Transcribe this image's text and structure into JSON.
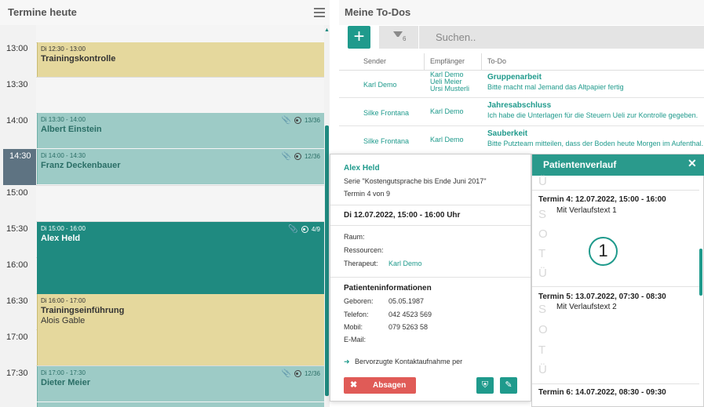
{
  "left": {
    "title": "Termine heute",
    "times": [
      "13:00",
      "13:30",
      "14:00",
      "14:30",
      "15:00",
      "15:30",
      "16:00",
      "16:30",
      "17:00",
      "17:30"
    ],
    "events": [
      {
        "time": "Di 12:30 - 13:00",
        "title": "Trainingskontrolle",
        "sub": "",
        "meta": "",
        "style": "yellow"
      },
      {
        "time": "Di 13:30 - 14:00",
        "title": "Albert Einstein",
        "sub": "",
        "meta": "13/36",
        "style": "teal"
      },
      {
        "time": "Di 14:00 - 14:30",
        "title": "Franz Deckenbauer",
        "sub": "",
        "meta": "12/36",
        "style": "teal"
      },
      {
        "time": "Di 15:00 - 16:00",
        "title": "Alex Held",
        "sub": "",
        "meta": "4/9",
        "style": "active"
      },
      {
        "time": "Di 16:00 - 17:00",
        "title": "Trainingseinführung",
        "sub": "Alois Gable",
        "meta": "",
        "style": "yellow"
      },
      {
        "time": "Di 17:00 - 17:30",
        "title": "Dieter Meier",
        "sub": "",
        "meta": "12/36",
        "style": "teal"
      }
    ]
  },
  "right": {
    "title": "Meine To-Dos",
    "add_label": "+",
    "filter_count": "6",
    "search_placeholder": "Suchen..",
    "columns": [
      "Sender",
      "Empfänger",
      "To-Do"
    ],
    "rows": [
      {
        "sender": "Karl Demo",
        "recv": [
          "Karl Demo",
          "Ueli Meier",
          "Ursi Musterli"
        ],
        "todo_title": "Gruppenarbeit",
        "todo_text": "Bitte macht mal Jemand das Altpapier fertig"
      },
      {
        "sender": "Silke Frontana",
        "recv": [
          "Karl Demo"
        ],
        "todo_title": "Jahresabschluss",
        "todo_text": "Ich habe die Unterlagen für die Steuern Ueli zur Kontrolle gegeben."
      },
      {
        "sender": "Silke Frontana",
        "recv": [
          "Karl Demo"
        ],
        "todo_title": "Sauberkeit",
        "todo_text": "Bitte Putzteam mitteilen, dass der Boden heute Morgen im Aufenthal..."
      }
    ]
  },
  "popup": {
    "name": "Alex Held",
    "series": "Serie \"Kostengutsprache bis Ende Juni 2017\"",
    "termin": "Termin 4 von 9",
    "date": "Di 12.07.2022, 15:00 - 16:00 Uhr",
    "raum_label": "Raum:",
    "ressourcen_label": "Ressourcen:",
    "therapeut_label": "Therapeut:",
    "therapeut": "Karl Demo",
    "patient_section": "Patienteninformationen",
    "geboren_label": "Geboren:",
    "geboren": "05.05.1987",
    "telefon_label": "Telefon:",
    "telefon": "042 4523 569",
    "mobil_label": "Mobil:",
    "mobil": "079 5263 58",
    "email_label": "E-Mail:",
    "contact": "Bervorzugte Kontaktaufnahme per",
    "absagen": "Absagen"
  },
  "verlauf": {
    "title": "Patientenverlauf",
    "soap": [
      "S",
      "O",
      "T",
      "Ü"
    ],
    "badge": "1",
    "entries": [
      {
        "title": "Termin 4: 12.07.2022, 15:00 - 16:00",
        "text": "Mit Verlaufstext 1"
      },
      {
        "title": "Termin 5: 13.07.2022, 07:30 - 08:30",
        "text": "Mit Verlaufstext 2"
      },
      {
        "title": "Termin 6: 14.07.2022, 08:30 - 09:30",
        "text": ""
      }
    ]
  },
  "colors": {
    "accent": "#1f9a8c",
    "active_event": "#1f8a80",
    "yellow_event": "#e5d89d",
    "teal_event": "#9dcbc6",
    "danger": "#e05b57"
  }
}
